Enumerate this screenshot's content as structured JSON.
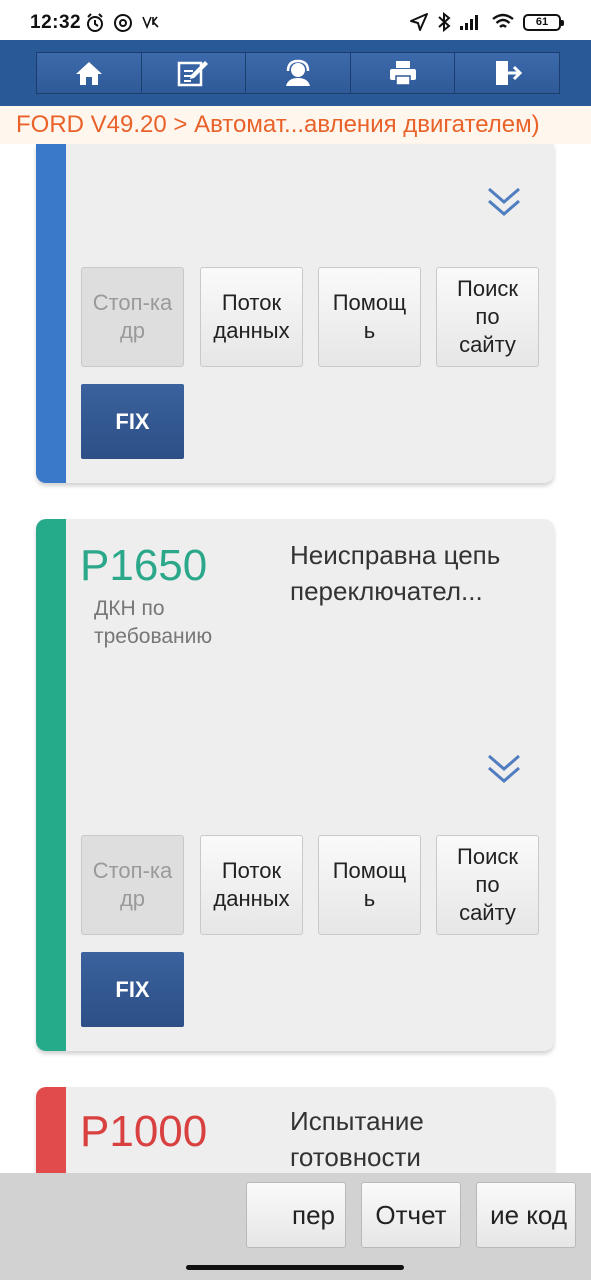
{
  "status": {
    "time": "12:32",
    "battery": "61",
    "left_icons": [
      "alarm-icon",
      "at-icon",
      "notification-icon"
    ],
    "right_icons": [
      "location-icon",
      "bluetooth-icon",
      "signal-icon",
      "wifi-icon",
      "battery-icon"
    ]
  },
  "toolbar": {
    "items": [
      "home-icon",
      "edit-icon",
      "support-icon",
      "print-icon",
      "exit-icon"
    ]
  },
  "breadcrumb": "FORD V49.20 > Автомат...авления двигателем)",
  "colors": {
    "toolbar": "#2a5998",
    "breadcrumb_text": "#e8622a",
    "stripe_blue": "#3a78c9",
    "stripe_green": "#26ab8a",
    "stripe_red": "#e24b4b",
    "code_green": "#2ba88a",
    "code_red": "#d94141",
    "fix_button": "#2f5489"
  },
  "cards": [
    {
      "buttons": {
        "freeze_frame": "Стоп-ка\nдр",
        "data_stream": "Поток\nданных",
        "help": "Помощ\nь",
        "search_site": "Поиск\nпо\nсайту",
        "fix": "FIX"
      }
    },
    {
      "code": "P1650",
      "subtitle": "ДКН по требованию",
      "description": "Неисправна цепь переключател...",
      "buttons": {
        "freeze_frame": "Стоп-ка\nдр",
        "data_stream": "Поток\nданных",
        "help": "Помощ\nь",
        "search_site": "Поиск\nпо\nсайту",
        "fix": "FIX"
      }
    },
    {
      "code": "P1000",
      "description": "Испытание готовности"
    }
  ],
  "bottom": {
    "btn1": "пер",
    "btn2": "Отчет",
    "btn3": "ие код"
  }
}
